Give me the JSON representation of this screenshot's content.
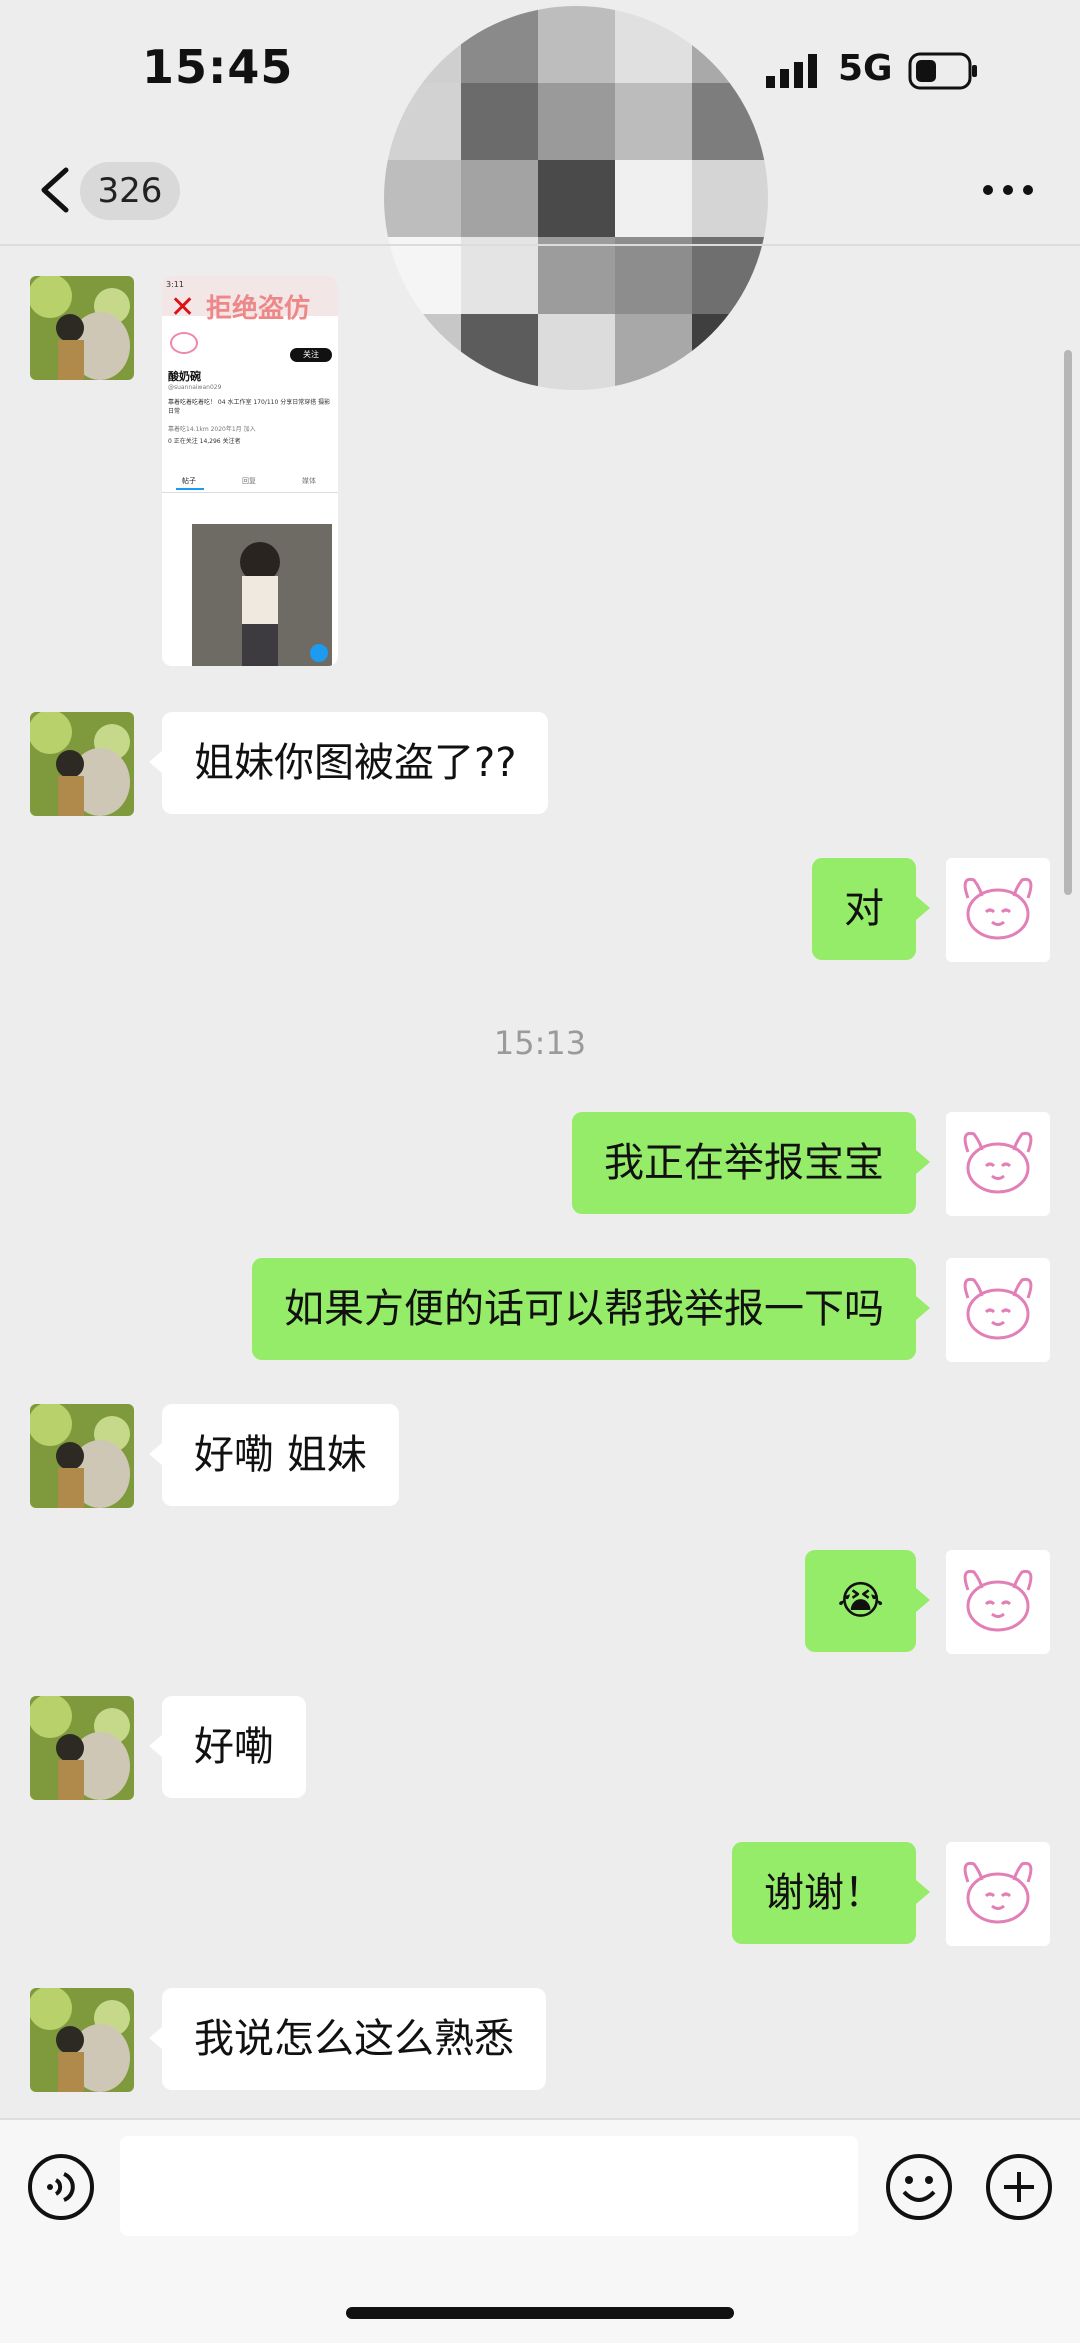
{
  "status_bar": {
    "time": "15:45",
    "network": "5G"
  },
  "header": {
    "unread_count": "326"
  },
  "shared_image": {
    "banner_text": "拒绝盗仿",
    "profile_name": "酸奶碗",
    "handle": "@suannaiwan029",
    "follow_label": "关注",
    "bio": "靠着吃着吃着吃！ 04 水工作室 170/110 分享日常穿搭 摄影 日常",
    "meta": "靠着吃14.1km  2020年1月 加入",
    "stats": "0 正在关注  14,296 关注者",
    "tabs": [
      "帖子",
      "回复",
      "媒体"
    ]
  },
  "messages": [
    {
      "side": "left",
      "text": "姐妹你图被盗了??"
    },
    {
      "side": "right",
      "text": "对"
    },
    {
      "side": "right",
      "text": "我正在举报宝宝"
    },
    {
      "side": "right",
      "text": "如果方便的话可以帮我举报一下吗"
    },
    {
      "side": "left",
      "text": "好嘞  姐妹"
    },
    {
      "side": "right",
      "text": "😭"
    },
    {
      "side": "left",
      "text": "好嘞"
    },
    {
      "side": "right",
      "text": "谢谢！"
    },
    {
      "side": "left",
      "text": "我说怎么这么熟悉"
    }
  ],
  "timestamp": "15:13",
  "colors": {
    "bubble_self": "#95ec69",
    "bubble_other": "#ffffff",
    "background": "#ededed"
  },
  "icons": [
    "back-icon",
    "more-icon",
    "voice-icon",
    "emoji-icon",
    "plus-icon"
  ]
}
